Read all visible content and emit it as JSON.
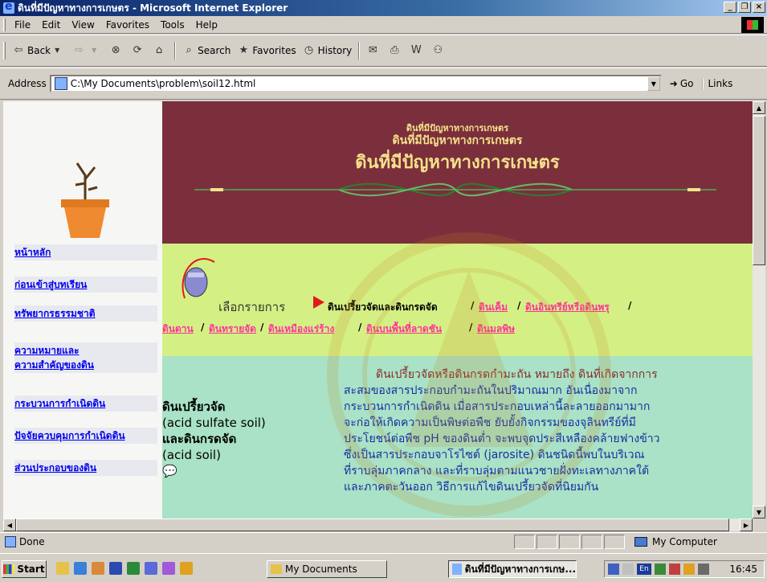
{
  "window": {
    "title": "ดินที่มีปัญหาทางการเกษตร - Microsoft Internet Explorer",
    "minimize": "_",
    "maximize": "❐",
    "close": "×"
  },
  "menu": [
    "File",
    "Edit",
    "View",
    "Favorites",
    "Tools",
    "Help"
  ],
  "toolbar": {
    "back": "Back",
    "search": "Search",
    "favorites": "Favorites",
    "history": "History"
  },
  "address": {
    "label": "Address",
    "value": "C:\\My Documents\\problem\\soil12.html",
    "go": "Go",
    "links": "Links"
  },
  "page": {
    "banner": {
      "line1": "ดินที่มีปัญหาทางการเกษตร",
      "line2": "ดินที่มีปัญหาทางการเกษตร",
      "line3": "ดินที่มีปัญหาทางการเกษตร"
    },
    "nav": [
      {
        "label": "หน้าหลัก"
      },
      {
        "label": "ก่อนเข้าสู่บทเรียน"
      },
      {
        "label": "ทรัพยากรธรรมชาติ"
      },
      {
        "label": "ความหมายและ"
      },
      {
        "label": "ความสำคัญของดิน"
      },
      {
        "label": "กระบวนการกำเนิดดิน"
      },
      {
        "label": "ปัจจัยควบคุมการกำเนิดดิน"
      },
      {
        "label": "ส่วนประกอบของดิน"
      }
    ],
    "select_label": "เลือกรายการ",
    "current_topic": "ดินเปรี้ยวจัดและดินกรดจัด",
    "topics_row1": [
      "ดินเค็ม",
      "ดินอินทรีย์หรือดินพรุ"
    ],
    "topics_row2": [
      "ดินดาน",
      "ดินทรายจัด",
      "ดินเหมืองแร่ร้าง",
      "ดินบนพื้นที่ลาดชัน",
      "ดินมลพิษ"
    ],
    "separator": "/",
    "soil_title": {
      "line1": "ดินเปรี้ยวจัด",
      "line2": "(acid sulfate soil)",
      "line3": "และดินกรดจัด",
      "line4": "(acid soil)"
    },
    "body_lines": [
      "ดินเปรี้ยวจัดหรือดินกรดกำมะถัน หมายถึง ดินที่เกิดจากการ",
      "สะสมของสารประกอบกำมะถันในปริมาณมาก อันเนื่องมาจาก",
      "กระบวนการกำเนิดดิน เมื่อสารประกอบเหล่านี้ละลายออกมามาก",
      "จะก่อให้เกิดความเป็นพิษต่อพืช ยับยั้งกิจกรรมของจุลินทรีย์ที่มี",
      "ประโยชน์ต่อพืช pH ของดินต่ำ จะพบจุดประสีเหลืองคล้ายฟางข้าว",
      "ซึ่งเป็นสารประกอบจาโรไซต์ (jarosite) ดินชนิดนี้พบในบริเวณ",
      "ที่ราบลุ่มภาคกลาง และที่ราบลุ่มตามแนวชายฝั่งทะเลทางภาคใต้",
      "และภาคตะวันออก วิธีการแก้ไขดินเปรี้ยวจัดที่นิยมกัน"
    ]
  },
  "status": {
    "done": "Done",
    "zone": "My Computer"
  },
  "taskbar": {
    "start": "Start",
    "task1": "My Documents",
    "task2": "ดินที่มีปัญหาทางการเกษ...",
    "clock": "16:45",
    "lang": "En"
  },
  "colors": {
    "banner_bg": "#7b2f3c",
    "banner_text": "#f4e28a",
    "green_band": "#d4f085",
    "teal_band": "#a9e2c6",
    "link_pink": "#ff3399",
    "nav_link": "#0000ee"
  }
}
